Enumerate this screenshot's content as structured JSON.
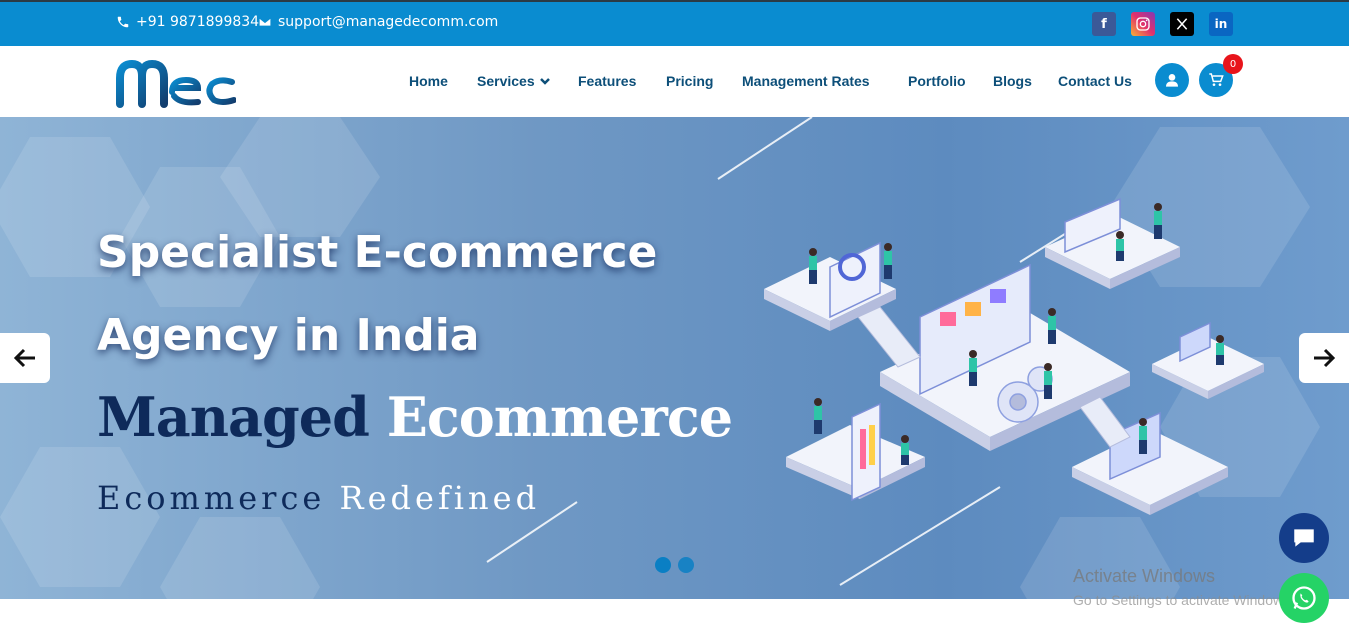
{
  "topbar": {
    "phone": "+91 9871899834",
    "email": "support@managedecomm.com",
    "social": [
      "facebook-icon",
      "instagram-icon",
      "x-icon",
      "linkedin-icon"
    ],
    "color": "#0a8cd0"
  },
  "nav": {
    "items": [
      {
        "label": "Home"
      },
      {
        "label": "Services"
      },
      {
        "label": "Features"
      },
      {
        "label": "Pricing"
      },
      {
        "label": "Management Rates"
      },
      {
        "label": "Portfolio"
      },
      {
        "label": "Blogs"
      },
      {
        "label": "Contact Us"
      }
    ],
    "cart_count": "0",
    "text_color": "#0d4f79"
  },
  "hero": {
    "line1": "Specialist E-commerce",
    "line2": "Agency in India",
    "brand_dark": "Managed",
    "brand_light": "Ecommerce",
    "tagline_dark": "Ecommerce",
    "tagline_light": "Redefined",
    "active_slide": 1,
    "slide_count": 2
  },
  "overlay": {
    "watermark_title": "Activate Windows",
    "watermark_sub": "Go to Settings to activate Windows."
  },
  "colors": {
    "accent": "#0a8cd0",
    "headline_dark": "#0e2a5a",
    "badge": "#e8141b",
    "whatsapp": "#25d366",
    "chat": "#143d8a"
  }
}
